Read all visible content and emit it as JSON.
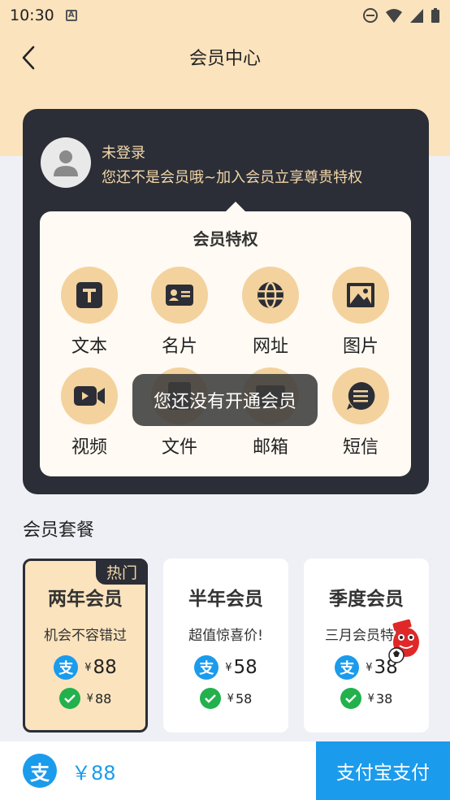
{
  "status_bar": {
    "time": "10:30"
  },
  "header": {
    "title": "会员中心"
  },
  "user": {
    "login_status": "未登录",
    "message": "您还不是会员哦~加入会员立享尊贵特权"
  },
  "privileges": {
    "title": "会员特权",
    "items": [
      {
        "label": "文本",
        "icon": "text-icon"
      },
      {
        "label": "名片",
        "icon": "business-card-icon"
      },
      {
        "label": "网址",
        "icon": "globe-icon"
      },
      {
        "label": "图片",
        "icon": "image-icon"
      },
      {
        "label": "视频",
        "icon": "video-icon"
      },
      {
        "label": "文件",
        "icon": "file-icon"
      },
      {
        "label": "邮箱",
        "icon": "mail-icon"
      },
      {
        "label": "短信",
        "icon": "message-icon"
      }
    ]
  },
  "toast": {
    "text": "您还没有开通会员"
  },
  "packages": {
    "title": "会员套餐",
    "hot_label": "热门",
    "items": [
      {
        "name": "两年会员",
        "desc": "机会不容错过",
        "alipay_price": "88",
        "wechat_price": "88",
        "selected": true
      },
      {
        "name": "半年会员",
        "desc": "超值惊喜价!",
        "alipay_price": "58",
        "wechat_price": "58",
        "selected": false
      },
      {
        "name": "季度会员",
        "desc": "三月会员特惠",
        "alipay_price": "38",
        "wechat_price": "38",
        "selected": false
      }
    ],
    "currency_symbol": "¥"
  },
  "bottom": {
    "price": "￥88",
    "pay_button": "支付宝支付"
  },
  "colors": {
    "accent_gold": "#fbe3bd",
    "dark_card": "#2b2e36",
    "alipay_blue": "#1b9bec",
    "wechat_green": "#22b14c"
  }
}
